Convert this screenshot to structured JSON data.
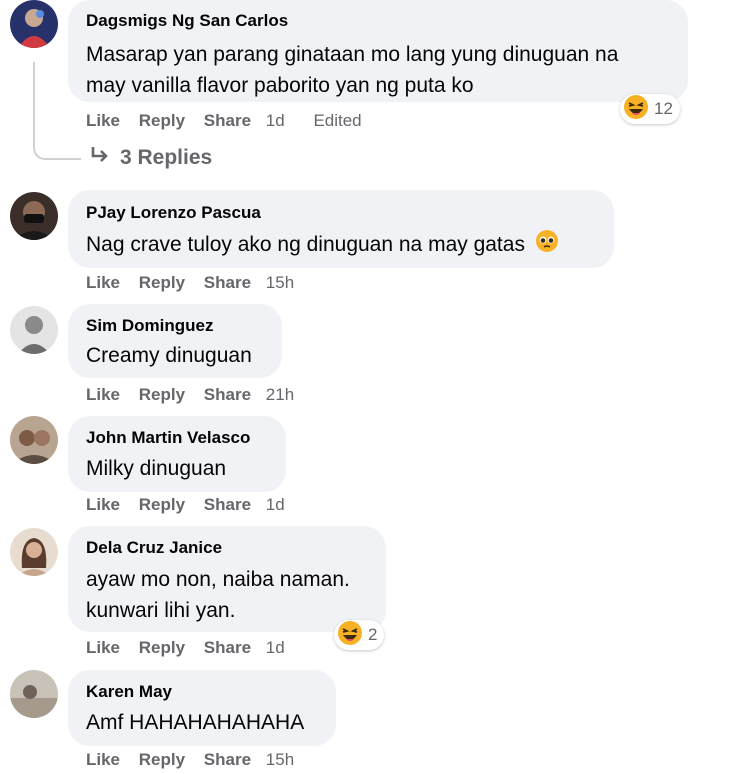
{
  "comments": [
    {
      "author": "Dagsmigs Ng San Carlos",
      "lines": [
        "Masarap yan parang ginataan mo lang yung dinuguan na",
        "may vanilla flavor paborito yan ng puta ko"
      ],
      "like": "Like",
      "reply": "Reply",
      "share": "Share",
      "time": "1d",
      "edited": "Edited",
      "reaction": {
        "icon": "laughing-emoji-icon",
        "count": "12"
      },
      "replies": "3 Replies"
    },
    {
      "author": "PJay Lorenzo Pascua",
      "lines": [
        "Nag crave tuloy ako ng dinuguan na may gatas"
      ],
      "emoji": "pleading-face-emoji-icon",
      "like": "Like",
      "reply": "Reply",
      "share": "Share",
      "time": "15h"
    },
    {
      "author": "Sim Dominguez",
      "lines": [
        "Creamy dinuguan"
      ],
      "like": "Like",
      "reply": "Reply",
      "share": "Share",
      "time": "21h"
    },
    {
      "author": "John Martin Velasco",
      "lines": [
        "Milky dinuguan"
      ],
      "like": "Like",
      "reply": "Reply",
      "share": "Share",
      "time": "1d"
    },
    {
      "author": "Dela Cruz Janice",
      "lines": [
        "ayaw mo non, naiba naman.",
        "kunwari lihi yan."
      ],
      "like": "Like",
      "reply": "Reply",
      "share": "Share",
      "time": "1d",
      "reaction": {
        "icon": "laughing-emoji-icon",
        "count": "2"
      }
    },
    {
      "author": "Karen May",
      "lines": [
        "Amf HAHAHAHAHAHA"
      ],
      "like": "Like",
      "reply": "Reply",
      "share": "Share",
      "time": "15h"
    }
  ],
  "colors": {
    "bubble": "#f0f2f5",
    "meta": "#65676b",
    "text": "#050505"
  }
}
